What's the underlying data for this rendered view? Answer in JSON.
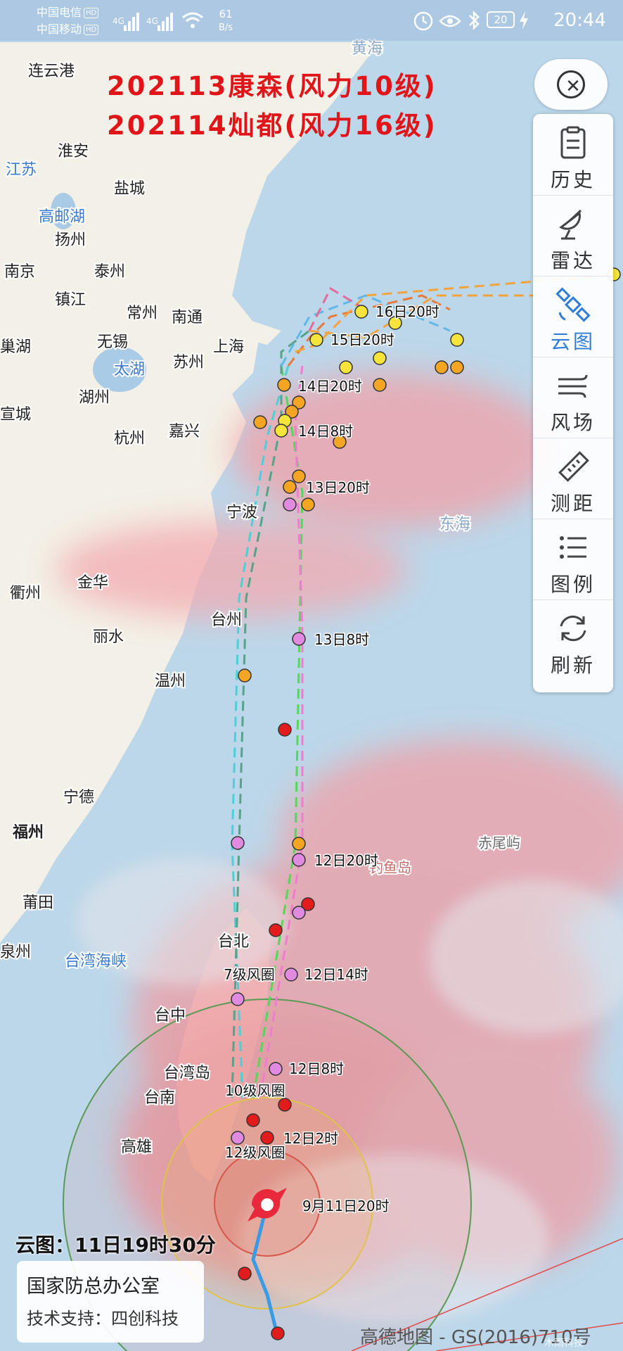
{
  "status_bar": {
    "carrier1": "中国电信",
    "carrier2": "中国移动",
    "hd": "HD",
    "net_a": "4G",
    "net_b": "4G",
    "speed_value": "61",
    "speed_unit": "B/s",
    "battery": "20",
    "time": "20:44"
  },
  "title": {
    "line1": "202113康森(风力10级)",
    "line2": "202114灿都(风力16级)"
  },
  "toolbar": [
    {
      "icon": "history-icon",
      "label": "历史"
    },
    {
      "icon": "radar-icon",
      "label": "雷达"
    },
    {
      "icon": "satellite-icon",
      "label": "云图",
      "active": true
    },
    {
      "icon": "wind-icon",
      "label": "风场"
    },
    {
      "icon": "ruler-icon",
      "label": "测距"
    },
    {
      "icon": "legend-icon",
      "label": "图例"
    },
    {
      "icon": "refresh-icon",
      "label": "刷新"
    }
  ],
  "cities": [
    "连云港",
    "淮安",
    "盐城",
    "高邮湖",
    "扬州",
    "南京",
    "泰州",
    "镇江",
    "常州",
    "南通",
    "无锡",
    "太湖",
    "苏州",
    "上海",
    "宣城",
    "湖州",
    "杭州",
    "嘉兴",
    "宁波",
    "金华",
    "衢州",
    "台州",
    "丽水",
    "温州",
    "宁德",
    "福州",
    "莆田",
    "泉州",
    "台湾海峡",
    "台北",
    "台中",
    "台湾岛",
    "台南",
    "高雄",
    "东海",
    "赤尾屿",
    "钓鱼岛",
    "黄海",
    "江苏",
    "巢湖"
  ],
  "track_labels": [
    "16日20时",
    "15日20时",
    "14日20时",
    "14日8时",
    "13日20时",
    "13日8时",
    "12日20时",
    "12日14时",
    "12日8时",
    "12日2时",
    "9月11日20时"
  ],
  "wind_circle_labels": [
    "7级风圈",
    "10级风圈",
    "12级风圈"
  ],
  "cloud_time_label": "云图：11日19时30分",
  "credit": {
    "line1": "国家防总办公室",
    "line2": "技术支持：四创科技"
  },
  "map_credit": "高德地图 - GS(2016)710号",
  "watermark": "木雨科技",
  "colors": {
    "title_red": "#e01419",
    "sea": "#bcd7ea",
    "land": "#f2efe6",
    "cloud": "#f2a0a6",
    "typhoon_icon": "#e8283b",
    "accent_blue": "#2f7dd6"
  }
}
